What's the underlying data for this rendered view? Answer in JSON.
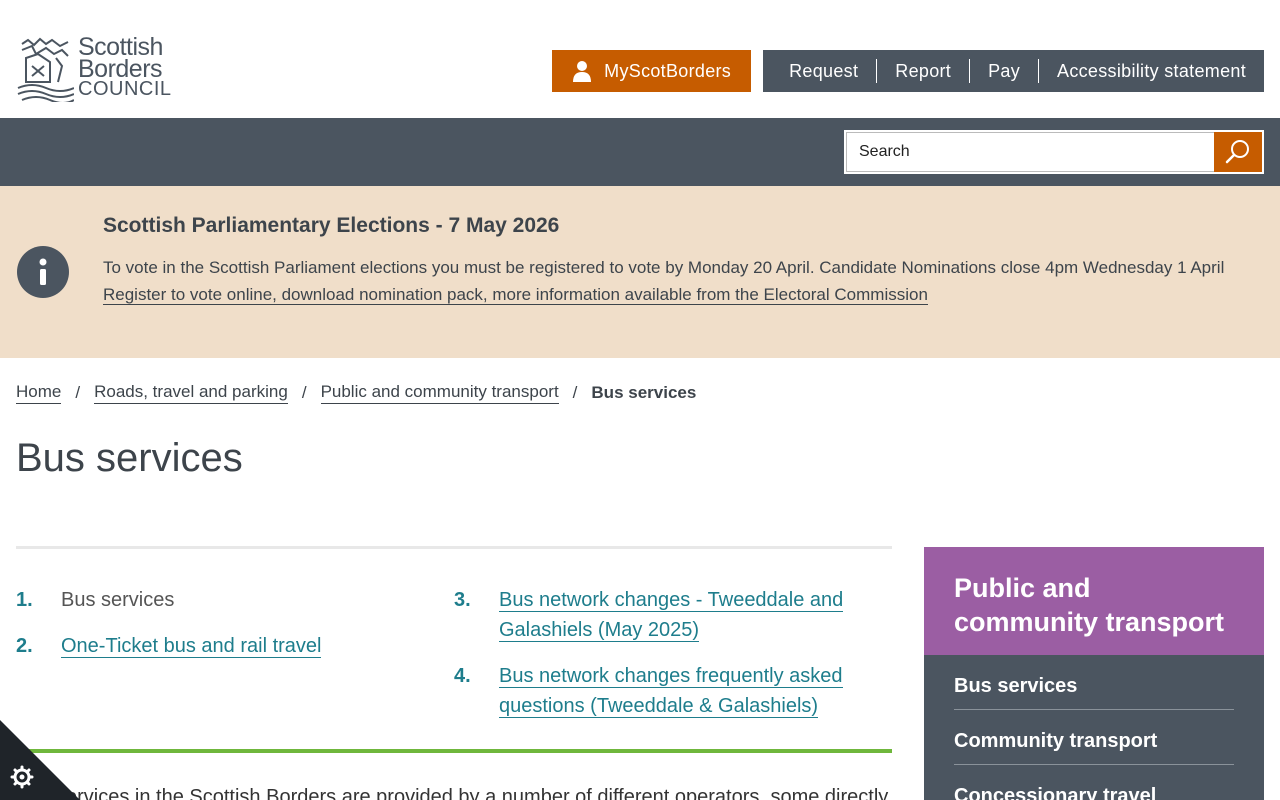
{
  "logo": {
    "line1": "Scottish",
    "line2": "Borders",
    "line3": "COUNCIL"
  },
  "header": {
    "my_account_label": "MyScotBorders",
    "nav": [
      "Request",
      "Report",
      "Pay",
      "Accessibility statement"
    ]
  },
  "search": {
    "placeholder": "Search"
  },
  "alert": {
    "title": "Scottish Parliamentary Elections - 7 May 2026",
    "text": "To vote in the Scottish Parliament elections you must be registered to vote by Monday 20 April. Candidate Nominations close 4pm Wednesday 1 April",
    "link": "Register to vote online, download nomination pack, more information available from the Electoral Commission"
  },
  "breadcrumb": {
    "items": [
      "Home",
      "Roads, travel and parking",
      "Public and community transport"
    ],
    "separator": "/",
    "current": "Bus services"
  },
  "page_title": "Bus services",
  "contents": {
    "items": [
      {
        "num": "1.",
        "label": "Bus services"
      },
      {
        "num": "2.",
        "label": "One-Ticket bus and rail travel"
      },
      {
        "num": "3.",
        "label": "Bus network changes - Tweeddale and Galashiels (May 2025)"
      },
      {
        "num": "4.",
        "label": "Bus network changes frequently asked questions (Tweeddale & Galashiels)"
      }
    ]
  },
  "intro": "Bus services in the Scottish Borders are provided by a number of different operators, some directly",
  "sidebar": {
    "title": "Public and community transport",
    "items": [
      "Bus services",
      "Community transport",
      "Concessionary travel"
    ]
  },
  "colors": {
    "accent_orange": "#c65c00",
    "slate": "#4b5560",
    "purple": "#9b5ea3",
    "teal_link": "#1e7d8c",
    "green_rule": "#6fb73c",
    "alert_bg": "#f0dec9"
  }
}
